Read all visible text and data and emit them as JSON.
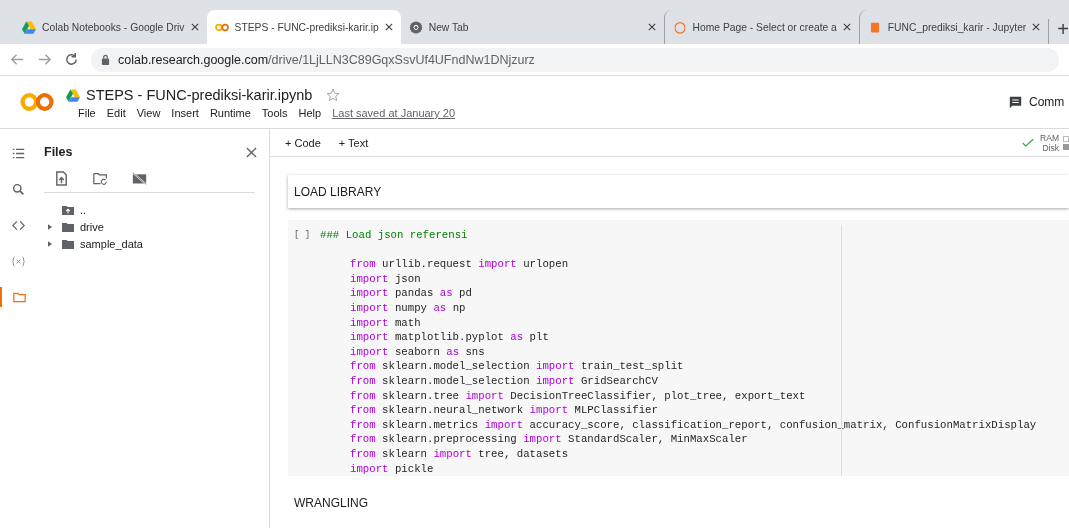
{
  "browser": {
    "tabs": [
      {
        "title": "Colab Notebooks - Google Driv",
        "selected": false
      },
      {
        "title": "STEPS - FUNC-prediksi-karir.ip",
        "selected": true
      },
      {
        "title": "New Tab",
        "selected": false
      },
      {
        "title": "Home Page - Select or create a",
        "selected": false
      },
      {
        "title": "FUNC_prediksi_karir - Jupyter",
        "selected": false
      }
    ],
    "new_tab": "+",
    "url_host": "colab.research.google.com",
    "url_path": "/drive/1LjLLN3C89GqxSsvUf4UFndNw1DNjzurz"
  },
  "notebook": {
    "title": "STEPS - FUNC-prediksi-karir.ipynb",
    "starred": false,
    "menu": [
      "File",
      "Edit",
      "View",
      "Insert",
      "Runtime",
      "Tools",
      "Help"
    ],
    "last_saved": "Last saved at January 20",
    "comment": "Comm",
    "toolbar": [
      "+ Code",
      "+ Text"
    ],
    "ram": "RAM",
    "disk": "Disk",
    "connected": true
  },
  "rail": [
    {
      "kind": "toc",
      "selected": false
    },
    {
      "kind": "search",
      "selected": false
    },
    {
      "kind": "code",
      "selected": false
    },
    {
      "kind": "variables",
      "selected": false
    },
    {
      "kind": "files",
      "selected": true
    }
  ],
  "files": {
    "title": "Files",
    "tree": [
      {
        "kind": "parent",
        "name": "..",
        "expandable": false
      },
      {
        "kind": "folder",
        "name": "drive",
        "expandable": true
      },
      {
        "kind": "folder",
        "name": "sample_data",
        "expandable": true
      }
    ]
  },
  "cells": [
    {
      "kind": "text",
      "text": "LOAD LIBRARY"
    },
    {
      "kind": "code",
      "prompt": "[ ]",
      "comment": "### Load json referensi",
      "lines": [
        [
          {
            "kind": "kw",
            "text": "from"
          },
          {
            "kind": "plain",
            "text": " urllib.request "
          },
          {
            "kind": "kw",
            "text": "import"
          },
          {
            "kind": "plain",
            "text": " urlopen"
          }
        ],
        [
          {
            "kind": "kw",
            "text": "import"
          },
          {
            "kind": "plain",
            "text": " json"
          }
        ],
        [
          {
            "kind": "kw",
            "text": "import"
          },
          {
            "kind": "plain",
            "text": " pandas "
          },
          {
            "kind": "kw",
            "text": "as"
          },
          {
            "kind": "plain",
            "text": " pd"
          }
        ],
        [
          {
            "kind": "kw",
            "text": "import"
          },
          {
            "kind": "plain",
            "text": " numpy "
          },
          {
            "kind": "kw",
            "text": "as"
          },
          {
            "kind": "plain",
            "text": " np"
          }
        ],
        [
          {
            "kind": "kw",
            "text": "import"
          },
          {
            "kind": "plain",
            "text": " math"
          }
        ],
        [
          {
            "kind": "kw",
            "text": "import"
          },
          {
            "kind": "plain",
            "text": " matplotlib.pyplot "
          },
          {
            "kind": "kw",
            "text": "as"
          },
          {
            "kind": "plain",
            "text": " plt"
          }
        ],
        [
          {
            "kind": "kw",
            "text": "import"
          },
          {
            "kind": "plain",
            "text": " seaborn "
          },
          {
            "kind": "kw",
            "text": "as"
          },
          {
            "kind": "plain",
            "text": " sns"
          }
        ],
        [
          {
            "kind": "kw",
            "text": "from"
          },
          {
            "kind": "plain",
            "text": " sklearn.model_selection "
          },
          {
            "kind": "kw",
            "text": "import"
          },
          {
            "kind": "plain",
            "text": " train_test_split"
          }
        ],
        [
          {
            "kind": "kw",
            "text": "from"
          },
          {
            "kind": "plain",
            "text": " sklearn.model_selection "
          },
          {
            "kind": "kw",
            "text": "import"
          },
          {
            "kind": "plain",
            "text": " GridSearchCV"
          }
        ],
        [
          {
            "kind": "kw",
            "text": "from"
          },
          {
            "kind": "plain",
            "text": " sklearn.tree "
          },
          {
            "kind": "kw",
            "text": "import"
          },
          {
            "kind": "plain",
            "text": " DecisionTreeClassifier, plot_tree, export_text"
          }
        ],
        [
          {
            "kind": "kw",
            "text": "from"
          },
          {
            "kind": "plain",
            "text": " sklearn.neural_network "
          },
          {
            "kind": "kw",
            "text": "import"
          },
          {
            "kind": "plain",
            "text": " MLPClassifier"
          }
        ],
        [
          {
            "kind": "kw",
            "text": "from"
          },
          {
            "kind": "plain",
            "text": " sklearn.metrics "
          },
          {
            "kind": "kw",
            "text": "import"
          },
          {
            "kind": "plain",
            "text": " accuracy_score, classification_report, confusion_matrix, ConfusionMatrixDisplay"
          }
        ],
        [
          {
            "kind": "kw",
            "text": "from"
          },
          {
            "kind": "plain",
            "text": " sklearn.preprocessing "
          },
          {
            "kind": "kw",
            "text": "import"
          },
          {
            "kind": "plain",
            "text": " StandardScaler, MinMaxScaler"
          }
        ],
        [
          {
            "kind": "kw",
            "text": "from"
          },
          {
            "kind": "plain",
            "text": " sklearn "
          },
          {
            "kind": "kw",
            "text": "import"
          },
          {
            "kind": "plain",
            "text": " tree, datasets"
          }
        ],
        [
          {
            "kind": "kw",
            "text": "import"
          },
          {
            "kind": "plain",
            "text": " pickle"
          }
        ]
      ]
    },
    {
      "kind": "heading",
      "text": "WRANGLING"
    }
  ]
}
